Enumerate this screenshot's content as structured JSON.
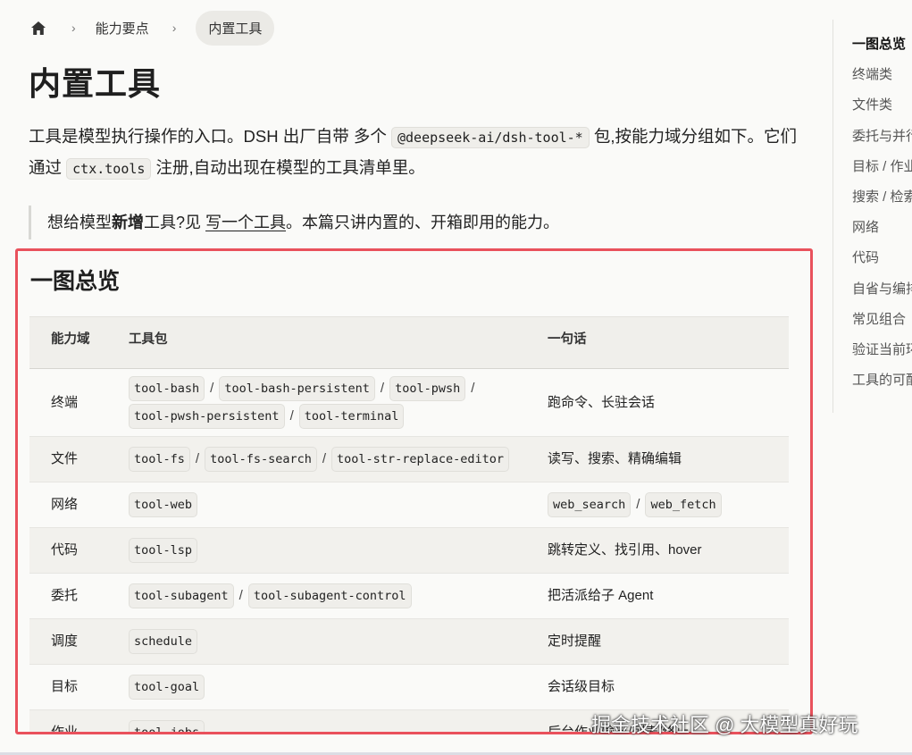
{
  "breadcrumb": {
    "home_icon": "home-icon",
    "separator": "›",
    "items": [
      "能力要点",
      "内置工具"
    ]
  },
  "page_title": "内置工具",
  "intro": {
    "p1": "工具是模型执行操作的入口。DSH 出厂自带 多个 ",
    "code1": "@deepseek-ai/dsh-tool-*",
    "p2": " 包,按能力域分组如下。它们通过 ",
    "code2": "ctx.tools",
    "p3": " 注册,自动出现在模型的工具清单里。"
  },
  "callout": {
    "t1": "想给模型",
    "bold": "新增",
    "t2": "工具?见 ",
    "link": "写一个工具",
    "t3": "。本篇只讲内置的、开箱即用的能力。"
  },
  "section": {
    "title": "一图总览",
    "highlight_color": "#e9515c",
    "table": {
      "headers": [
        "能力域",
        "工具包",
        "一句话"
      ],
      "rows": [
        {
          "domain": "终端",
          "packages": [
            "tool-bash",
            "tool-bash-persistent",
            "tool-pwsh",
            "tool-pwsh-persistent",
            "tool-terminal"
          ],
          "summary": "跑命令、长驻会话"
        },
        {
          "domain": "文件",
          "packages": [
            "tool-fs",
            "tool-fs-search",
            "tool-str-replace-editor"
          ],
          "summary": "读写、搜索、精确编辑"
        },
        {
          "domain": "网络",
          "packages": [
            "tool-web"
          ],
          "summary_code": [
            "web_search",
            "web_fetch"
          ]
        },
        {
          "domain": "代码",
          "packages": [
            "tool-lsp"
          ],
          "summary": "跳转定义、找引用、hover"
        },
        {
          "domain": "委托",
          "packages": [
            "tool-subagent",
            "tool-subagent-control"
          ],
          "summary": "把活派给子 Agent"
        },
        {
          "domain": "调度",
          "packages": [
            "schedule"
          ],
          "summary": "定时提醒"
        },
        {
          "domain": "目标",
          "packages": [
            "tool-goal"
          ],
          "summary": "会话级目标"
        },
        {
          "domain": "作业",
          "packages": [
            "tool-jobs"
          ],
          "summary": "后台作业输出/列表/终止"
        }
      ]
    }
  },
  "toc": {
    "items": [
      "一图总览",
      "终端类",
      "文件类",
      "委托与并行",
      "目标 / 作业",
      "搜索 / 检索",
      "网络",
      "代码",
      "自省与编排",
      "常见组合",
      "验证当前环境",
      "工具的可配置"
    ]
  },
  "watermark": "掘金技术社区 @ 大模型真好玩"
}
